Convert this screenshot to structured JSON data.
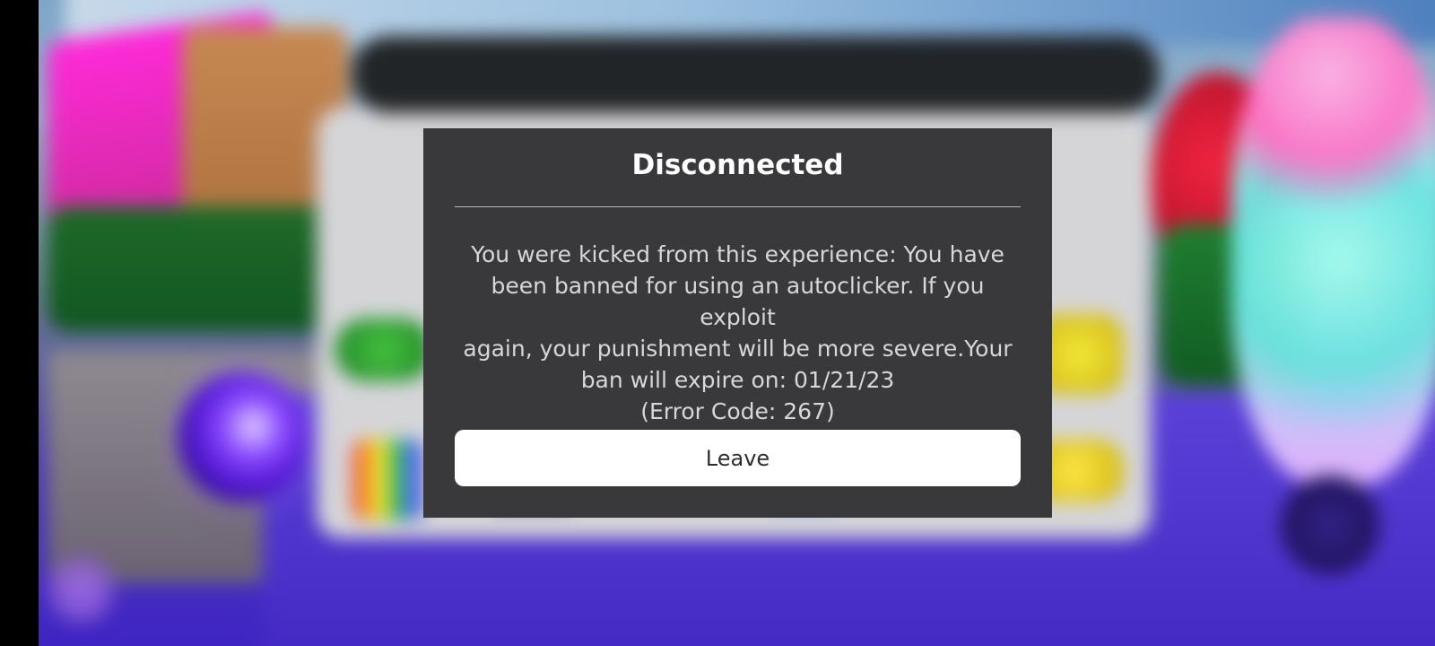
{
  "dialog": {
    "title": "Disconnected",
    "message_lines": [
      "You were kicked from this experience: You have",
      "been banned for using an autoclicker. If you exploit",
      "again, your punishment will be more severe.Your",
      "ban will expire on: 01/21/23",
      "(Error Code: 267)"
    ],
    "leave_label": "Leave"
  },
  "colors": {
    "dialog_background": "#39393b",
    "dialog_title": "#ffffff",
    "dialog_text": "#d7d7d7",
    "button_background": "#ffffff",
    "button_text": "#2e2e2e"
  }
}
